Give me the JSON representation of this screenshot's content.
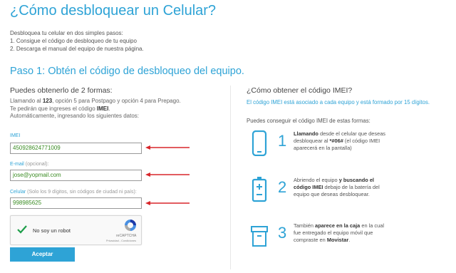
{
  "title": "¿Cómo desbloquear un Celular?",
  "intro": {
    "line1": "Desbloquea tu celular en dos simples pasos:",
    "line2": "1. Consigue el código de desbloqueo de tu equipo",
    "line3": "2. Descarga el manual del equipo de nuestra página."
  },
  "step_title": "Paso 1: Obtén el código de desbloqueo del equipo.",
  "left": {
    "subtitle": "Puedes obtenerlo de 2 formas:",
    "desc_a": "Llamando al ",
    "desc_b": "123",
    "desc_c": ",  opción 5 para Postpago y opción 4 para Prepago.",
    "desc_d": "  Te pedirán que ingreses el código ",
    "desc_e": "IMEI",
    "desc_f": ".",
    "desc_g": "Automáticamente, ingresando los siguientes datos:"
  },
  "form": {
    "imei_label": "IMEI",
    "imei_value": "450928624771009",
    "email_label": "E-mail",
    "email_hint": " (opcional):",
    "email_value": "jose@yopmail.com",
    "cel_label": "Celular",
    "cel_hint": " (Solo los 9 dígitos, sin códigos de ciudad ni país):",
    "cel_value": "998985625"
  },
  "captcha": {
    "label": "No soy un robot",
    "brand": "reCAPTCHA",
    "links": "Privacidad - Condiciones"
  },
  "submit_label": "Aceptar",
  "right": {
    "heading": "¿Cómo obtener el código IMEI?",
    "blue_text": "El código IMEI está asociado a cada equipo y está formado por 15 dígitos.",
    "sub_text": "Puedes conseguir el código IMEI de estas formas:",
    "ways": [
      {
        "num": "1",
        "bold1": "Llamando",
        "t1": " desde el celular que deseas desbloquear al ",
        "bold2": "*#06#",
        "t2": " (el código IMEI aparecerá en la pantalla)"
      },
      {
        "num": "2",
        "t0": "Abriendo el equipo ",
        "bold1": "y buscando el código IMEI",
        "t1": " debajo de la batería del equipo que deseas desbloquear."
      },
      {
        "num": "3",
        "t0": "También ",
        "bold1": "aparece en la caja",
        "t1": " en la cual fue entregado el equipo móvil que compraste en ",
        "bold2": "Movistar",
        "t2": "."
      }
    ]
  },
  "colors": {
    "accent": "#2ea3d6",
    "arrow": "#d8262b",
    "input_text": "#3a8c23"
  }
}
